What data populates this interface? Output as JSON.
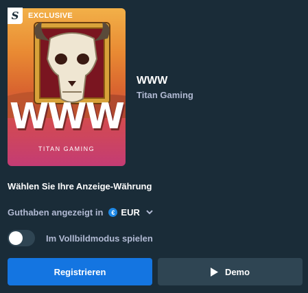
{
  "game": {
    "cover_badge_letter": "S",
    "cover_badge": "EXCLUSIVE",
    "cover_title": "WWW",
    "cover_studio": "TITAN GAMING",
    "title": "WWW",
    "studio": "Titan Gaming"
  },
  "currency": {
    "heading": "Wählen Sie Ihre Anzeige-Währung",
    "label": "Guthaben angezeigt in",
    "icon_symbol": "€",
    "selected": "EUR"
  },
  "fullscreen": {
    "label": "Im Vollbildmodus spielen",
    "enabled": false
  },
  "buttons": {
    "register": "Registrieren",
    "demo": "Demo"
  },
  "colors": {
    "background": "#1a2c38",
    "primary": "#1475e1",
    "secondary": "#2f4553",
    "muted_text": "#b1bad3"
  }
}
